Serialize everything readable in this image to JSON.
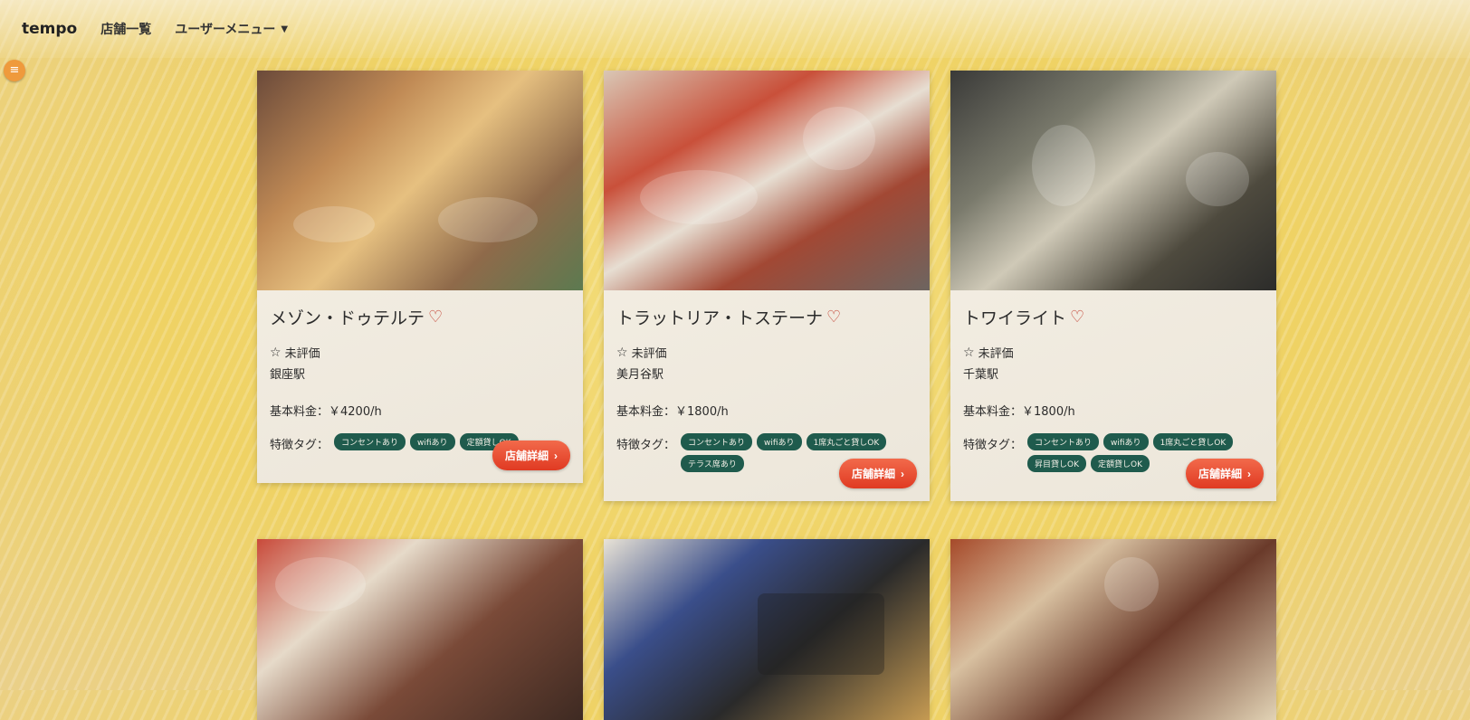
{
  "header": {
    "brand": "tempo",
    "nav_store_list": "店舗一覧",
    "nav_user_menu": "ユーザーメニュー"
  },
  "sidebar_toggle": "≡",
  "icons": {
    "heart": "heart-outline-icon",
    "star": "star-outline-icon",
    "chevron": "chevron-right-icon"
  },
  "colors": {
    "accent_button": "#e8452b",
    "tag_bg": "#1f5b4d",
    "heart": "#c0392b"
  },
  "labels": {
    "rating_unrated": "未評価",
    "price_prefix": "基本料金：",
    "tags_label": "特徴タグ：",
    "detail_button": "店舗詳細"
  },
  "stores": [
    {
      "name": "メゾン・ドゥテルテ",
      "rating": "未評価",
      "station": "銀座駅",
      "price": "￥4200/h",
      "tags": [
        "コンセントあり",
        "wifiあり",
        "定額貸しOK"
      ]
    },
    {
      "name": "トラットリア・トステーナ",
      "rating": "未評価",
      "station": "美月谷駅",
      "price": "￥1800/h",
      "tags": [
        "コンセントあり",
        "wifiあり",
        "1席丸ごと貸しOK",
        "テラス席あり"
      ]
    },
    {
      "name": "トワイライト",
      "rating": "未評価",
      "station": "千葉駅",
      "price": "￥1800/h",
      "tags": [
        "コンセントあり",
        "wifiあり",
        "1席丸ごと貸しOK",
        "昇目貸しOK",
        "定額貸しOK"
      ]
    }
  ]
}
